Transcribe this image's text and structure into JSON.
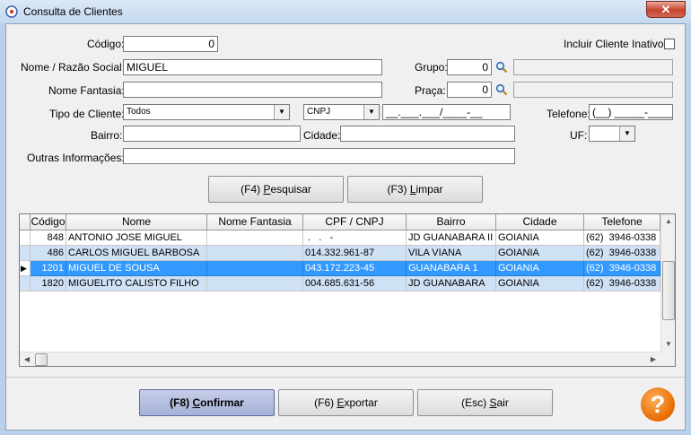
{
  "window": {
    "title": "Consulta de Clientes",
    "close_symbol": "✕"
  },
  "form": {
    "codigo_label": "Código:",
    "codigo_value": "0",
    "incluir_inativo_label": "Incluir Cliente Inativo:",
    "nome_label": "Nome / Razão Social:",
    "nome_value": "MIGUEL",
    "grupo_label": "Grupo:",
    "grupo_value": "0",
    "nome_fantasia_label": "Nome Fantasia:",
    "nome_fantasia_value": "",
    "praca_label": "Praça:",
    "praca_value": "0",
    "tipo_cliente_label": "Tipo de Cliente:",
    "tipo_cliente_value": "Todos",
    "doc_tipo_value": "CNPJ",
    "doc_mask": "__.___.___/____-__",
    "telefone_label": "Telefone:",
    "telefone_mask": "(__) _____-____",
    "bairro_label": "Bairro:",
    "cidade_label": "Cidade:",
    "uf_label": "UF:",
    "outras_label": "Outras Informações:"
  },
  "buttons": {
    "pesquisar_prefix": "(F4) ",
    "pesquisar_key": "P",
    "pesquisar_rest": "esquisar",
    "limpar_prefix": "(F3) ",
    "limpar_key": "L",
    "limpar_rest": "impar",
    "confirmar_prefix": "(F8) ",
    "confirmar_key": "C",
    "confirmar_rest": "onfirmar",
    "exportar_prefix": "(F6) ",
    "exportar_key": "E",
    "exportar_rest": "xportar",
    "sair_prefix": "(Esc) ",
    "sair_key": "S",
    "sair_rest": "air",
    "help_symbol": "?"
  },
  "grid": {
    "columns": [
      "Código",
      "Nome",
      "Nome Fantasia",
      "CPF / CNPJ",
      "Bairro",
      "Cidade",
      "Telefone"
    ],
    "rows": [
      {
        "codigo": "848",
        "nome": "ANTONIO JOSE MIGUEL",
        "fantasia": "",
        "doc": " .   .   -",
        "bairro": "JD GUANABARA II",
        "cidade": "GOIANIA",
        "telefone": "(62)  3946-0338"
      },
      {
        "codigo": "486",
        "nome": "CARLOS MIGUEL BARBOSA",
        "fantasia": "",
        "doc": "014.332.961-87",
        "bairro": "VILA VIANA",
        "cidade": "GOIANIA",
        "telefone": "(62)  3946-0338"
      },
      {
        "codigo": "1201",
        "nome": "MIGUEL DE SOUSA",
        "fantasia": "",
        "doc": "043.172.223-45",
        "bairro": "GUANABARA 1",
        "cidade": "GOIANIA",
        "telefone": "(62)  3946-0338"
      },
      {
        "codigo": "1820",
        "nome": "MIGUELITO CALISTO FILHO",
        "fantasia": "",
        "doc": "004.685.631-56",
        "bairro": "JD GUANABARA",
        "cidade": "GOIANIA",
        "telefone": "(62)  3946-0338"
      }
    ],
    "selected_row_index": 2
  },
  "icons": {
    "app": "app-icon",
    "search": "magnifier-icon",
    "dropdown": "chevron-down-icon",
    "help": "help-icon"
  }
}
